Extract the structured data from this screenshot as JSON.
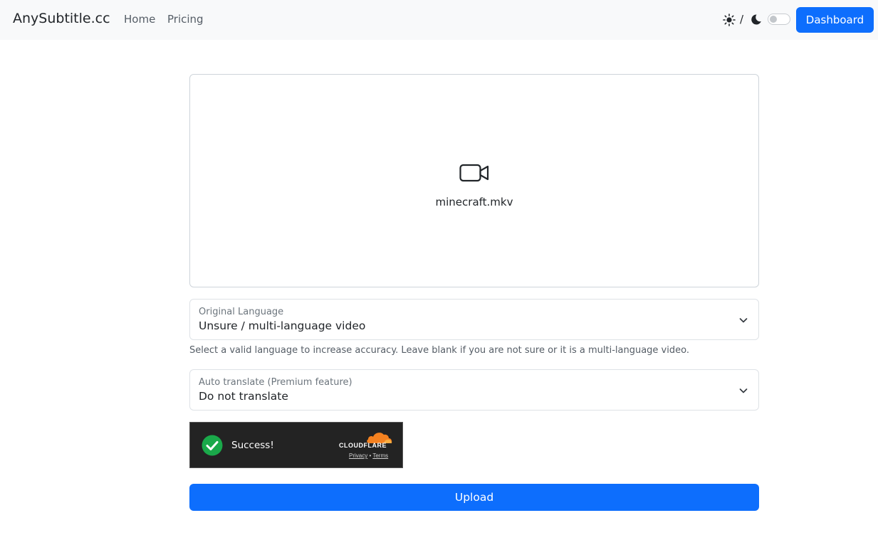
{
  "navbar": {
    "brand": "AnySubtitle.cc",
    "links": [
      "Home",
      "Pricing"
    ],
    "theme_separator": "/",
    "dashboard_label": "Dashboard",
    "sun_icon": "sun-icon",
    "moon_icon": "moon-icon"
  },
  "dropzone": {
    "icon": "video-camera-icon",
    "file_name": "minecraft.mkv"
  },
  "original_language": {
    "label": "Original Language",
    "value": "Unsure / multi-language video",
    "help": "Select a valid language to increase accuracy. Leave blank if you are not sure or it is a multi-language video."
  },
  "auto_translate": {
    "label": "Auto translate (Premium feature)",
    "value": "Do not translate"
  },
  "turnstile": {
    "status": "Success!",
    "brand": "CLOUDFLARE",
    "privacy": "Privacy",
    "separator": "•",
    "terms": "Terms"
  },
  "upload_label": "Upload",
  "colors": {
    "primary": "#0d6efd",
    "navbar_bg": "#f8f9fa",
    "turnstile_bg": "#232323",
    "success_green": "#1aa94a",
    "cloudflare_orange": "#f48120"
  }
}
